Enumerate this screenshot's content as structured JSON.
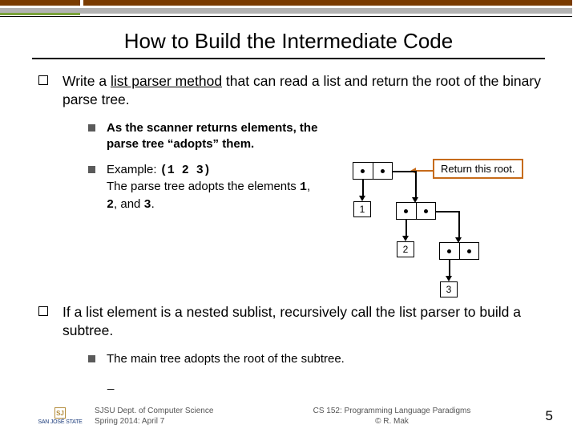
{
  "title": "How to Build the Intermediate Code",
  "bullet1": {
    "pre": "Write a ",
    "u": "list parser method",
    "post": " that can read a list and return the root of the binary parse tree."
  },
  "sub": {
    "a": "As the scanner returns elements, the parse tree “adopts” them.",
    "b": {
      "pre": "Example: ",
      "code": "(1 2 3)",
      "line2_pre": "The parse tree adopts the elements ",
      "c1": "1",
      "sep1": ", ",
      "c2": "2",
      "sep2": ", and ",
      "c3": "3",
      "end": "."
    }
  },
  "callout": "Return this root.",
  "nodes": {
    "n1": "1",
    "n2": "2",
    "n3": "3"
  },
  "bullet2": "If a list element is a nested sublist, recursively call the list parser to build a subtree.",
  "sub2": "The main tree adopts the root of the subtree.",
  "cursor": "_",
  "footer": {
    "dept1": "SJSU Dept. of Computer Science",
    "dept2": "Spring 2014: April 7",
    "course": "CS 152: Programming Language Paradigms",
    "author": "© R. Mak",
    "page": "5",
    "logo_abbr": "SJ",
    "logo_text": "SAN JOSÉ STATE"
  }
}
